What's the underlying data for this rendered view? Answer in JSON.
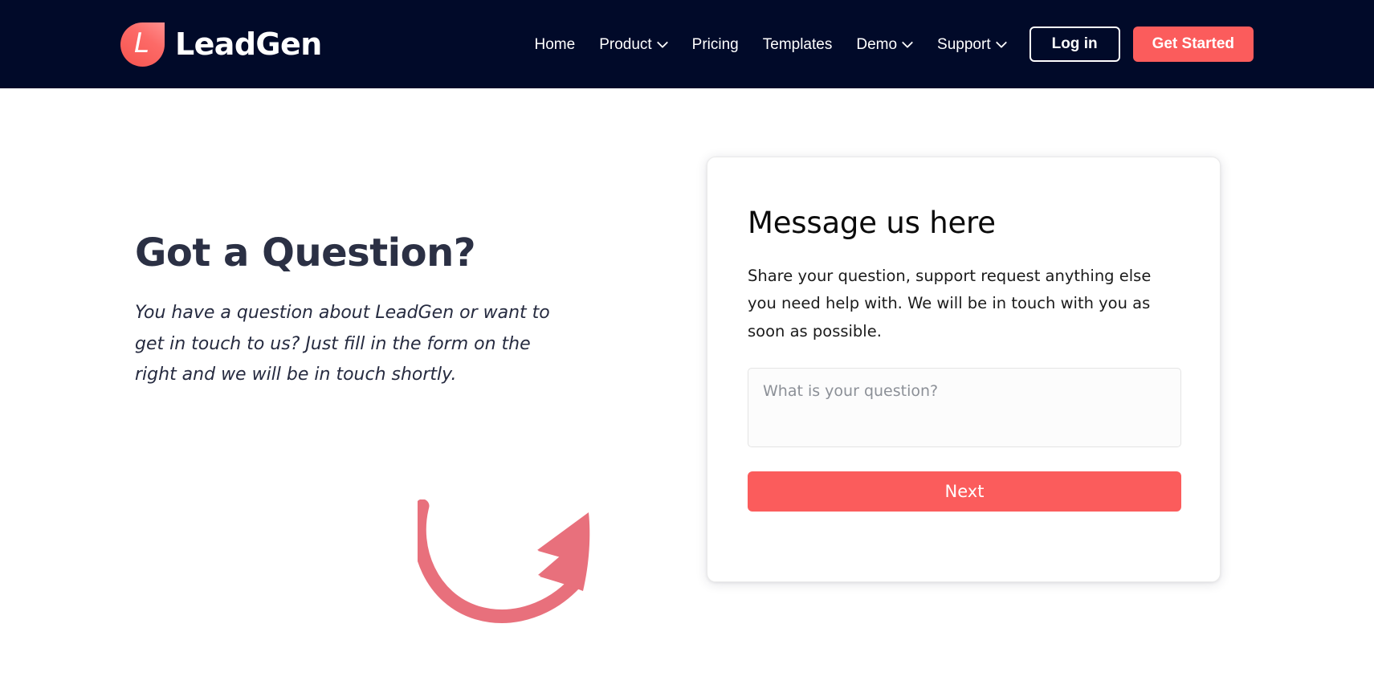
{
  "brand": {
    "name": "LeadGen",
    "mark_letter": "L",
    "mark_gradient_from": "#FF8E8E",
    "mark_gradient_to": "#F6544F"
  },
  "header": {
    "background": "#010A29",
    "nav": [
      {
        "label": "Home",
        "has_dropdown": false
      },
      {
        "label": "Product",
        "has_dropdown": true
      },
      {
        "label": "Pricing",
        "has_dropdown": false
      },
      {
        "label": "Templates",
        "has_dropdown": false
      },
      {
        "label": "Demo",
        "has_dropdown": true
      },
      {
        "label": "Support",
        "has_dropdown": true
      }
    ],
    "login_label": "Log in",
    "get_started_label": "Get Started",
    "accent_color": "#FB5C5C"
  },
  "intro": {
    "title": "Got a Question?",
    "text": "You have a question about LeadGen or want to get in touch to us? Just fill in the form on the right and we will be in touch shortly."
  },
  "decoration": {
    "arrow_icon": "curved-arrow-icon",
    "arrow_color": "#E8707C"
  },
  "form_card": {
    "title": "Message us here",
    "description": "Share your question, support request anything else you need help with. We will be in touch with you as soon as possible.",
    "question_placeholder": "What is your question?",
    "question_value": "",
    "next_label": "Next",
    "next_color": "#FB5C5C"
  }
}
